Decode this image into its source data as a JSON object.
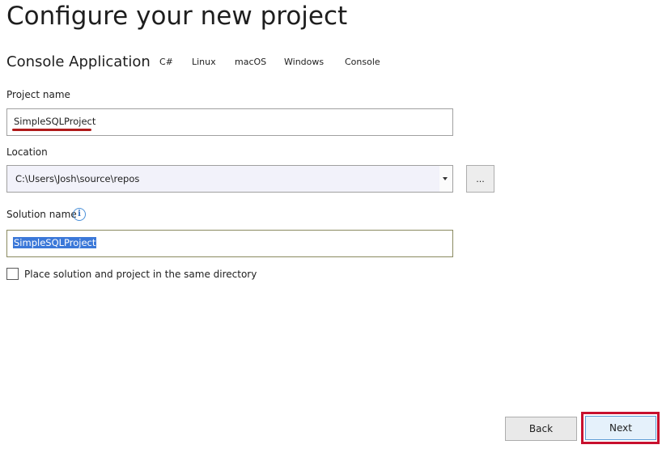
{
  "page": {
    "title": "Configure your new project",
    "template_name": "Console Application",
    "tags": [
      "C#",
      "Linux",
      "macOS",
      "Windows",
      "Console"
    ]
  },
  "form": {
    "project_name": {
      "label": "Project name",
      "value": "SimpleSQLProject"
    },
    "location": {
      "label": "Location",
      "value": "C:\\Users\\Josh\\source\\repos",
      "browse_label": "..."
    },
    "solution_name": {
      "label": "Solution name",
      "value": "SimpleSQLProject",
      "info_icon": "i"
    },
    "same_directory": {
      "label": "Place solution and project in the same directory",
      "checked": false
    }
  },
  "footer": {
    "back_label": "Back",
    "next_label": "Next"
  },
  "colors": {
    "highlight_box": "#c8102e",
    "selection": "#3b78d8",
    "underline": "#b01a1a"
  }
}
